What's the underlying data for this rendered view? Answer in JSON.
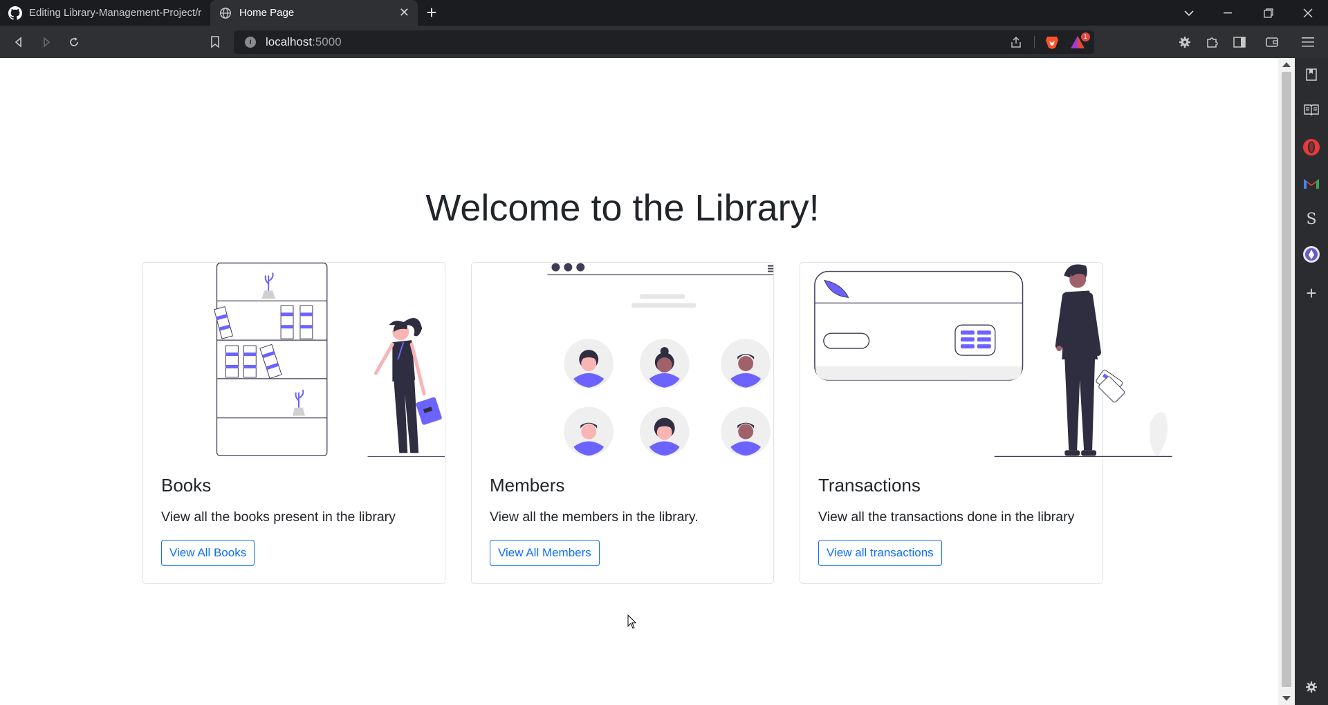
{
  "browser": {
    "tabs": [
      {
        "title": "Editing Library-Management-Project/r",
        "icon": "github-icon",
        "active": false
      },
      {
        "title": "Home Page",
        "icon": "globe-icon",
        "active": true
      }
    ],
    "address": {
      "host": "localhost",
      "port": ":5000"
    },
    "rewards_badge": "1"
  },
  "page": {
    "heading": "Welcome to the Library!",
    "cards": [
      {
        "title": "Books",
        "text": "View all the books present in the library",
        "button": "View All Books"
      },
      {
        "title": "Members",
        "text": "View all the members in the library.",
        "button": "View All Members"
      },
      {
        "title": "Transactions",
        "text": "View all the transactions done in the library",
        "button": "View all transactions"
      }
    ]
  },
  "colors": {
    "accent": "#6c63ff",
    "primary": "#0d6efd",
    "dark_figure": "#2f2e41",
    "chrome_bg": "#1b1c1f"
  }
}
